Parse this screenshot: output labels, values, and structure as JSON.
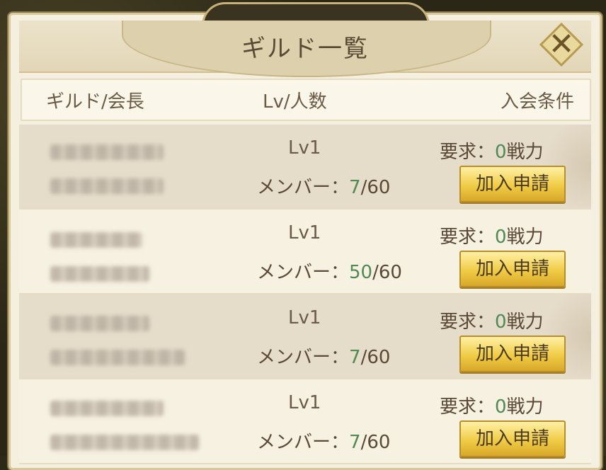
{
  "window": {
    "title": "ギルド一覧"
  },
  "header": {
    "col_name": "ギルド/会長",
    "col_level": "Lv/人数",
    "col_condition": "入会条件"
  },
  "rows": [
    {
      "level": "Lv1",
      "members_label": "メンバー：",
      "members_current": "7",
      "members_max": "/60",
      "req_label": "要求：",
      "req_value": "0",
      "req_unit": "戦力",
      "join_label": "加入申請"
    },
    {
      "level": "Lv1",
      "members_label": "メンバー：",
      "members_current": "50",
      "members_max": "/60",
      "req_label": "要求：",
      "req_value": "0",
      "req_unit": "戦力",
      "join_label": "加入申請"
    },
    {
      "level": "Lv1",
      "members_label": "メンバー：",
      "members_current": "7",
      "members_max": "/60",
      "req_label": "要求：",
      "req_value": "0",
      "req_unit": "戦力",
      "join_label": "加入申請"
    },
    {
      "level": "Lv1",
      "members_label": "メンバー：",
      "members_current": "7",
      "members_max": "/60",
      "req_label": "要求：",
      "req_value": "0",
      "req_unit": "戦力",
      "join_label": "加入申請"
    }
  ],
  "colors": {
    "accent_green": "#4f8a55",
    "button_gold": "#f0cc45",
    "text_brown": "#5a4a35"
  }
}
